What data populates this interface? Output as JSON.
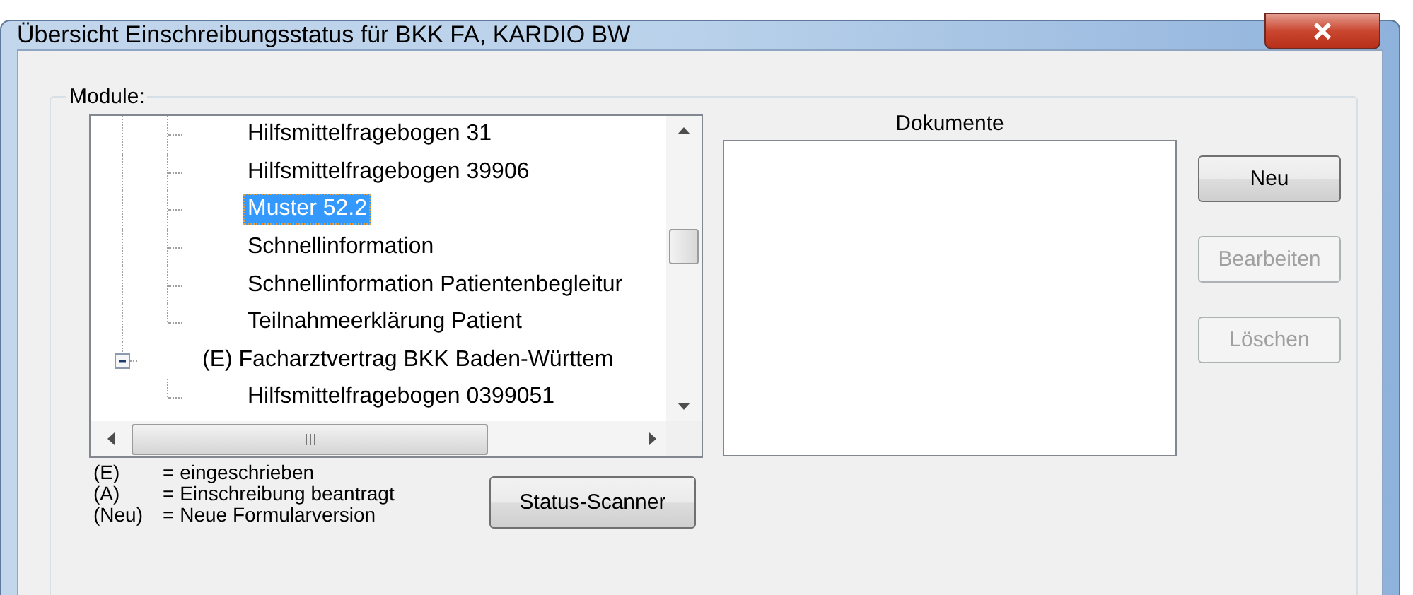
{
  "window": {
    "title": "Übersicht Einschreibungsstatus für BKK FA, KARDIO BW"
  },
  "modules": {
    "label": "Module:",
    "tree": {
      "nodes": [
        {
          "kind": "continued",
          "children": [
            {
              "label": "Hilfsmittelfragebogen 31",
              "selected": false
            },
            {
              "label": "Hilfsmittelfragebogen 39906",
              "selected": false
            },
            {
              "label": "Muster 52.2",
              "selected": true
            },
            {
              "label": "Schnellinformation",
              "selected": false
            },
            {
              "label": "Schnellinformation Patientenbegleitur",
              "selected": false
            },
            {
              "label": "Teilnahmeerklärung Patient",
              "selected": false
            }
          ]
        },
        {
          "kind": "node",
          "label": "(E) Facharztvertrag BKK Baden-Württem",
          "selected": false,
          "expanded": true,
          "children": [
            {
              "label": "Hilfsmittelfragebogen 0399051",
              "selected": false
            }
          ]
        }
      ]
    }
  },
  "legend": [
    {
      "key": "(E)",
      "text": "= eingeschrieben"
    },
    {
      "key": "(A)",
      "text": "= Einschreibung beantragt"
    },
    {
      "key": "(Neu)",
      "text": "= Neue Formularversion"
    }
  ],
  "status_scanner_button": {
    "label": "Status-Scanner"
  },
  "documents": {
    "label": "Dokumente"
  },
  "buttons": [
    {
      "label": "Neu",
      "disabled": false
    },
    {
      "label": "Bearbeiten",
      "disabled": true
    },
    {
      "label": "Löschen",
      "disabled": true
    }
  ]
}
